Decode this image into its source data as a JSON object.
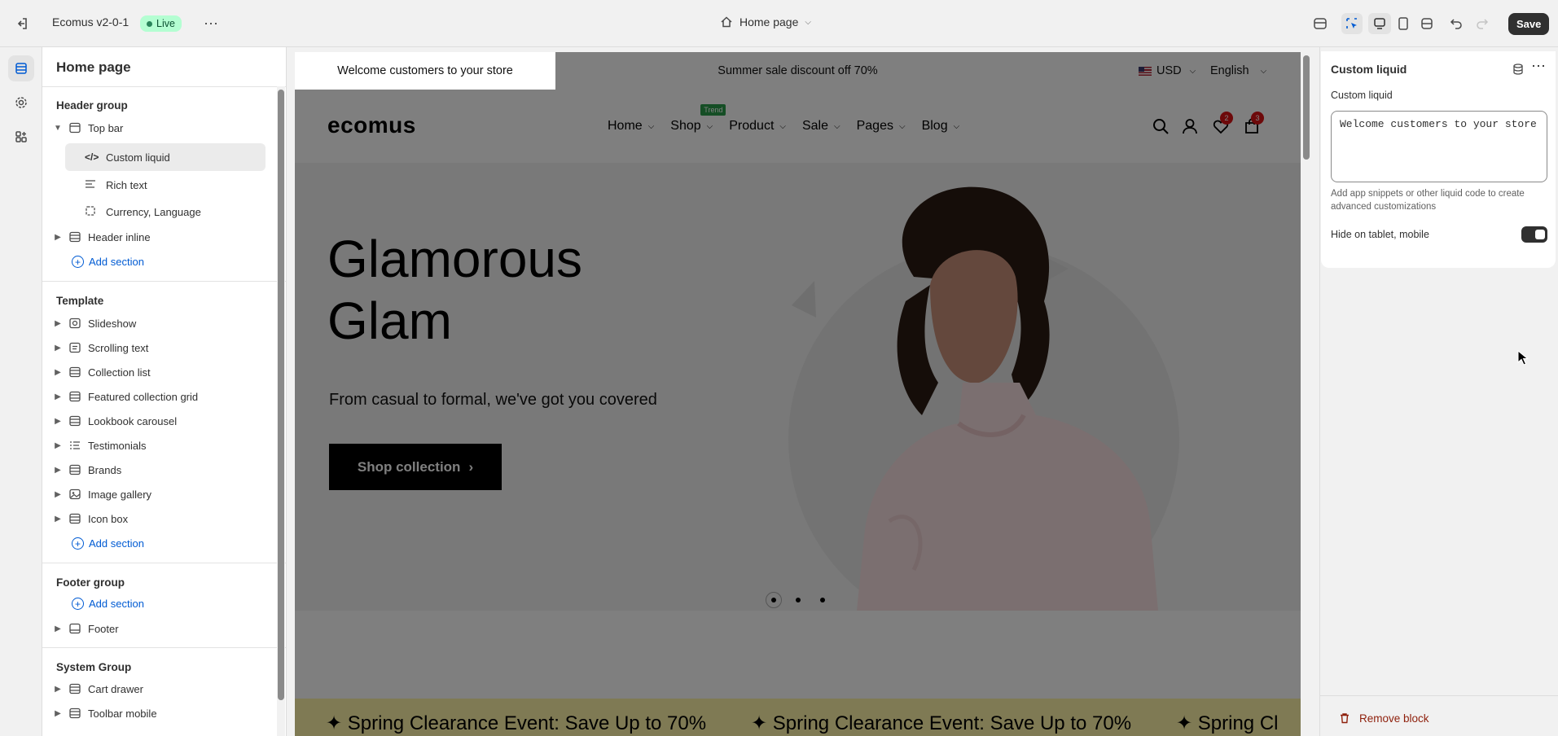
{
  "topbar": {
    "store_name": "Ecomus v2-0-1",
    "status_badge": "Live",
    "page_selector": "Home page",
    "save_label": "Save"
  },
  "sidebar": {
    "title": "Home page",
    "header_group": {
      "title": "Header group",
      "top_bar": "Top bar",
      "blocks": [
        "Custom liquid",
        "Rich text",
        "Currency, Language"
      ],
      "header_inline": "Header inline",
      "add_section": "Add section"
    },
    "template": {
      "title": "Template",
      "sections": [
        "Slideshow",
        "Scrolling text",
        "Collection list",
        "Featured collection grid",
        "Lookbook carousel",
        "Testimonials",
        "Brands",
        "Image gallery",
        "Icon box"
      ],
      "add_section": "Add section"
    },
    "footer_group": {
      "title": "Footer group",
      "add_section": "Add section",
      "footer": "Footer"
    },
    "system_group": {
      "title": "System Group",
      "sections": [
        "Cart drawer",
        "Toolbar mobile"
      ]
    }
  },
  "store": {
    "announcement_left": "Welcome customers to your store",
    "announcement_center": "Summer sale discount off 70%",
    "currency": "USD",
    "language": "English",
    "logo": "ecomus",
    "nav": [
      {
        "label": "Home"
      },
      {
        "label": "Shop",
        "badge": "Trend"
      },
      {
        "label": "Product"
      },
      {
        "label": "Sale"
      },
      {
        "label": "Pages"
      },
      {
        "label": "Blog"
      }
    ],
    "wishlist_count": "2",
    "cart_count": "3",
    "hero_title_line1": "Glamorous",
    "hero_title_line2": "Glam",
    "hero_subtitle": "From casual to formal, we've got you covered",
    "hero_button": "Shop collection",
    "marquee_text": "Spring Clearance Event: Save Up to 70%",
    "marquee_partial": "Spring Cl"
  },
  "panel": {
    "title": "Custom liquid",
    "field_label": "Custom liquid",
    "field_value": "Welcome customers to your store",
    "help_text": "Add app snippets or other liquid code to create advanced customizations",
    "toggle_label": "Hide on tablet, mobile",
    "toggle_on": true,
    "remove_label": "Remove block"
  },
  "colors": {
    "accent": "#005bd3",
    "badge_green": "#29845a",
    "announce_bg": "#ffffff",
    "marquee_bg": "#fff5a8",
    "remove_red": "#8e1f0b",
    "count_red": "#db1215",
    "trend_green": "#2a9d4b"
  }
}
